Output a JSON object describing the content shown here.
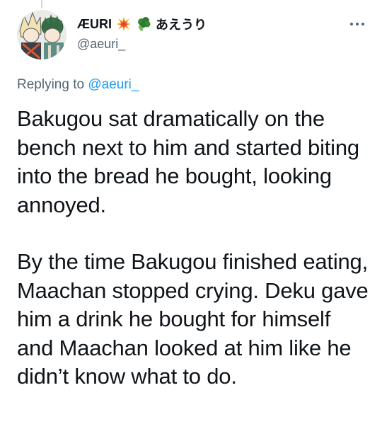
{
  "author": {
    "display_name": "ÆURI",
    "emoji_icons": [
      "collision-icon",
      "broccoli-icon"
    ],
    "jp_name": "あえうり",
    "handle": "@aeuri_"
  },
  "reply_context": {
    "prefix": "Replying to",
    "mention": "@aeuri_"
  },
  "tweet": {
    "paragraphs": [
      "Bakugou sat dramatically on the bench next to him and started biting into the bread he bought, looking annoyed.",
      "By the time Bakugou finished eating, Maachan stopped crying. Deku gave him a drink he bought for himself and Maachan looked at him like he didn’t know what to do."
    ]
  },
  "more_icon": "more-horizontal-icon",
  "colors": {
    "text_primary": "#0f1419",
    "text_secondary": "#536471",
    "link": "#1d9bf0"
  }
}
